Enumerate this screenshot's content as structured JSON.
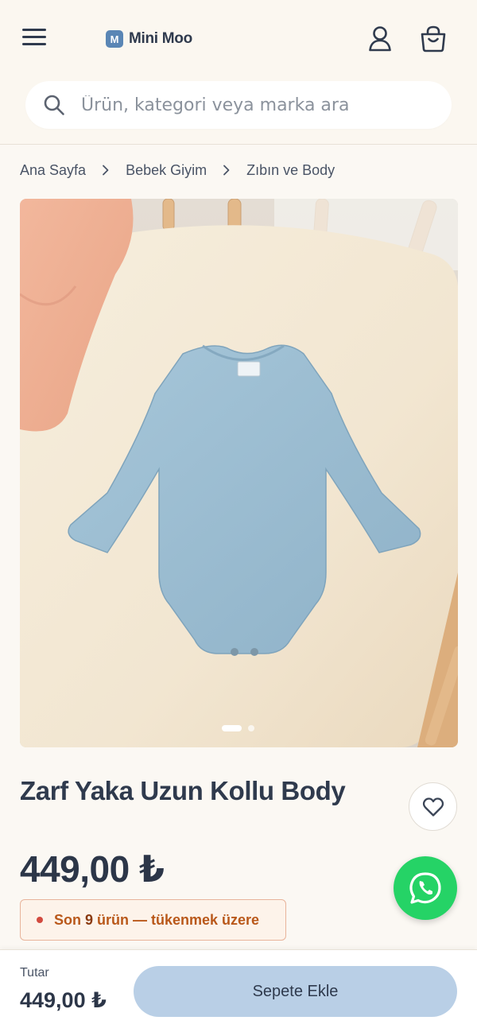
{
  "header": {
    "logo_mark": "M",
    "logo_text": "Mini Moo"
  },
  "search": {
    "placeholder": "Ürün, kategori veya marka ara",
    "value": ""
  },
  "breadcrumb": {
    "items": [
      "Ana Sayfa",
      "Bebek Giyim",
      "Zıbın ve Body"
    ]
  },
  "gallery": {
    "image_count": 2,
    "active_index": 0
  },
  "product": {
    "title": "Zarf Yaka Uzun Kollu Body",
    "price": "449,00 ₺",
    "stock": {
      "prefix": "Son",
      "count": "9",
      "suffix": "ürün — tükenmek üzere"
    }
  },
  "bottom_bar": {
    "total_label": "Tutar",
    "total_value": "449,00 ₺",
    "add_to_cart_label": "Sepete Ekle"
  },
  "colors": {
    "accent": "#b9cfe6",
    "brand": "#5a86b5",
    "whatsapp": "#25d366",
    "warning": "#b9581a"
  },
  "icons": [
    "menu-icon",
    "account-icon",
    "cart-icon",
    "search-icon",
    "chevron-right-icon",
    "heart-icon",
    "whatsapp-icon"
  ]
}
